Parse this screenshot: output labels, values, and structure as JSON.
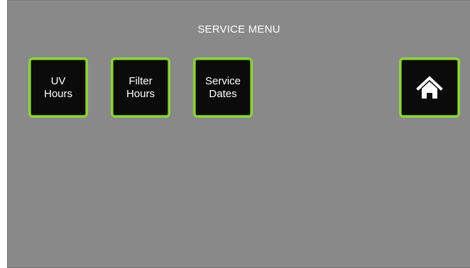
{
  "title": "SERVICE MENU",
  "buttons": {
    "uv_hours": "UV\nHours",
    "filter_hours": "Filter\nHours",
    "service_dates": "Service\nDates"
  },
  "icons": {
    "home": "home-icon"
  },
  "colors": {
    "background": "#898989",
    "button_fill": "#0b0b0b",
    "button_border": "#8dd33b",
    "text": "#ffffff"
  }
}
